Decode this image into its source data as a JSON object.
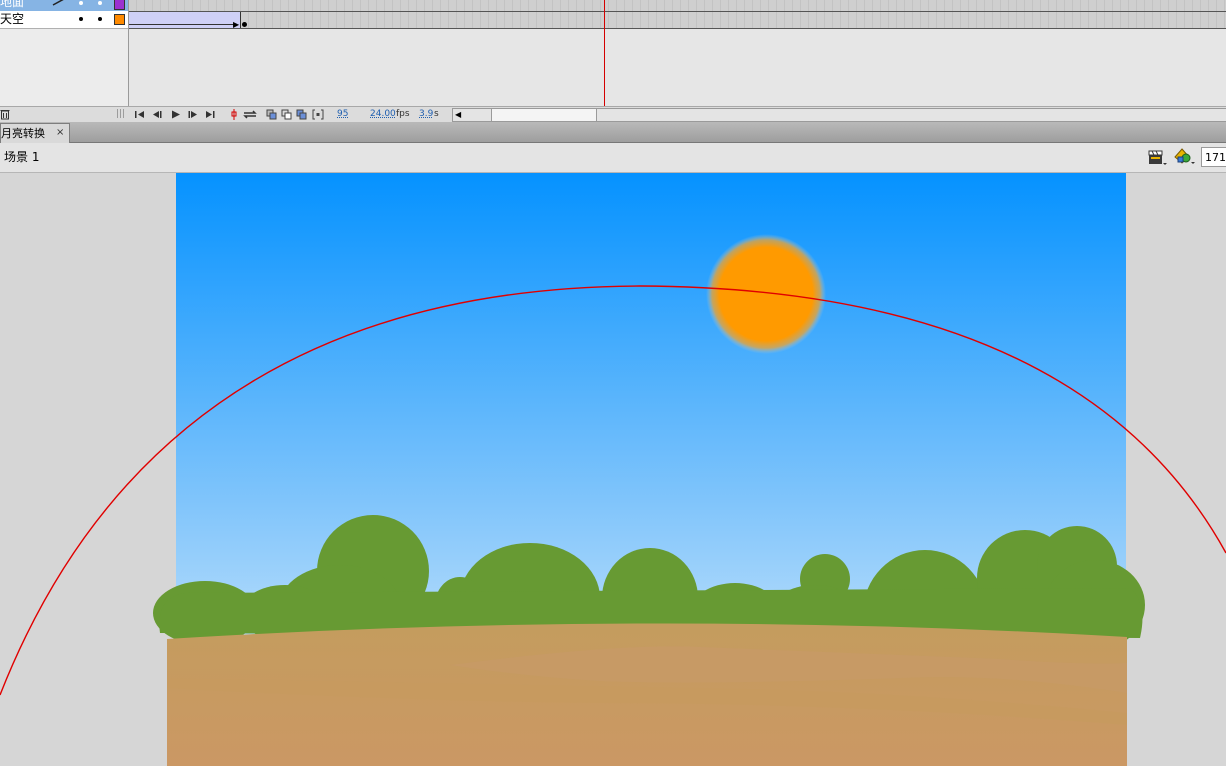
{
  "timeline": {
    "layers": [
      {
        "name": "地面",
        "color": "#9b30d0"
      },
      {
        "name": "天空",
        "color": "#ff8a00"
      }
    ],
    "current_frame": "95",
    "frame_rate": "24.00",
    "frame_rate_unit": "fps",
    "elapsed_time": "3.9",
    "elapsed_time_unit": "s"
  },
  "document_tab": {
    "title": "月亮转换",
    "close_glyph": "×"
  },
  "edit_bar": {
    "scene_name": "场景 1",
    "zoom": "171"
  },
  "icons": [
    "pencil-icon",
    "trash-icon",
    "first-frame-icon",
    "step-back-icon",
    "play-icon",
    "step-forward-icon",
    "last-frame-icon",
    "center-frame-icon",
    "loop-icon",
    "onion-skin-icon",
    "onion-outline-icon",
    "edit-multiple-frames-icon",
    "modify-markers-icon",
    "edit-scene-icon",
    "edit-symbol-icon"
  ],
  "colors": {
    "sky_top": "#0592ff",
    "sky_bottom": "#e6f2fc",
    "sun": "#ff9a00",
    "bushes": "#679a33",
    "ground_top": "#c49c5e",
    "ground_bottom": "#cb9864",
    "motion_guide": "#e00000",
    "playhead": "#d40000"
  }
}
